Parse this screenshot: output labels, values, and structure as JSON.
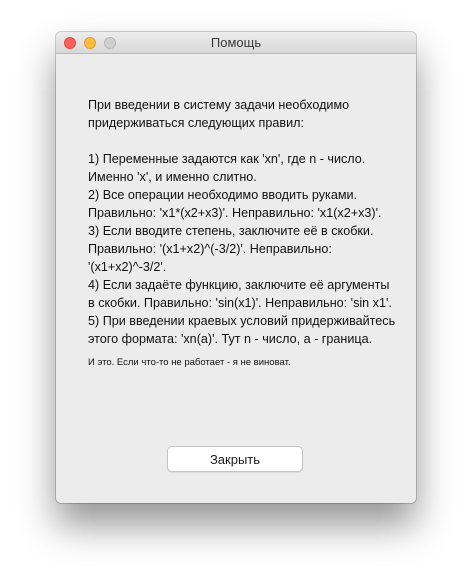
{
  "window": {
    "title": "Помощь",
    "traffic_lights": [
      "close",
      "minimize",
      "zoom"
    ]
  },
  "body": {
    "text": "При введении в систему задачи необходимо придерживаться следующих правил:\n\n1) Переменные задаются как 'xn', где n - число. Именно 'x', и именно слитно.\n2) Все операции необходимо вводить руками. Правильно: 'x1*(x2+x3)'. Неправильно: 'x1(x2+x3)'.\n3) Если вводите степень, заключите её в скобки. Правильно: '(x1+x2)^(-3/2)'. Неправильно: '(x1+x2)^-3/2'.\n4) Если задаёте функцию, заключите её аргументы в скобки. Правильно: 'sin(x1)'. Неправильно: 'sin x1'.\n5) При введении краевых условий придерживайтесь этого формата: 'xn(a)'. Тут n - число, a - граница.",
    "note": "И это. Если что-то не работает - я не виноват."
  },
  "buttons": {
    "close_label": "Закрыть"
  },
  "colors": {
    "window_background": "#ececec",
    "close_light": "#fc605c",
    "minimize_light": "#fdbc40",
    "zoom_light": "#cfcfcf"
  }
}
